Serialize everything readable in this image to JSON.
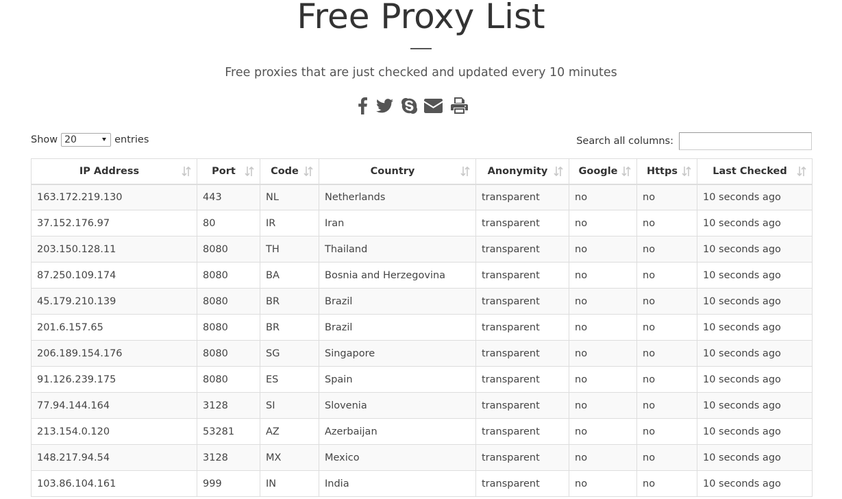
{
  "header": {
    "title": "Free Proxy List",
    "subtitle": "Free proxies that are just checked and updated every 10 minutes"
  },
  "share": {
    "icons": [
      "facebook-icon",
      "twitter-icon",
      "skype-icon",
      "envelope-icon",
      "print-icon"
    ],
    "icon_color": "#555555"
  },
  "controls": {
    "show_label": "Show",
    "entries_value": "20",
    "entries_label": "entries",
    "search_label": "Search all columns:",
    "search_value": ""
  },
  "table": {
    "columns": [
      "IP Address",
      "Port",
      "Code",
      "Country",
      "Anonymity",
      "Google",
      "Https",
      "Last Checked"
    ],
    "rows": [
      [
        "163.172.219.130",
        "443",
        "NL",
        "Netherlands",
        "transparent",
        "no",
        "no",
        "10 seconds ago"
      ],
      [
        "37.152.176.97",
        "80",
        "IR",
        "Iran",
        "transparent",
        "no",
        "no",
        "10 seconds ago"
      ],
      [
        "203.150.128.11",
        "8080",
        "TH",
        "Thailand",
        "transparent",
        "no",
        "no",
        "10 seconds ago"
      ],
      [
        "87.250.109.174",
        "8080",
        "BA",
        "Bosnia and Herzegovina",
        "transparent",
        "no",
        "no",
        "10 seconds ago"
      ],
      [
        "45.179.210.139",
        "8080",
        "BR",
        "Brazil",
        "transparent",
        "no",
        "no",
        "10 seconds ago"
      ],
      [
        "201.6.157.65",
        "8080",
        "BR",
        "Brazil",
        "transparent",
        "no",
        "no",
        "10 seconds ago"
      ],
      [
        "206.189.154.176",
        "8080",
        "SG",
        "Singapore",
        "transparent",
        "no",
        "no",
        "10 seconds ago"
      ],
      [
        "91.126.239.175",
        "8080",
        "ES",
        "Spain",
        "transparent",
        "no",
        "no",
        "10 seconds ago"
      ],
      [
        "77.94.144.164",
        "3128",
        "SI",
        "Slovenia",
        "transparent",
        "no",
        "no",
        "10 seconds ago"
      ],
      [
        "213.154.0.120",
        "53281",
        "AZ",
        "Azerbaijan",
        "transparent",
        "no",
        "no",
        "10 seconds ago"
      ],
      [
        "148.217.94.54",
        "3128",
        "MX",
        "Mexico",
        "transparent",
        "no",
        "no",
        "10 seconds ago"
      ],
      [
        "103.86.104.161",
        "999",
        "IN",
        "India",
        "transparent",
        "no",
        "no",
        "10 seconds ago"
      ]
    ]
  }
}
